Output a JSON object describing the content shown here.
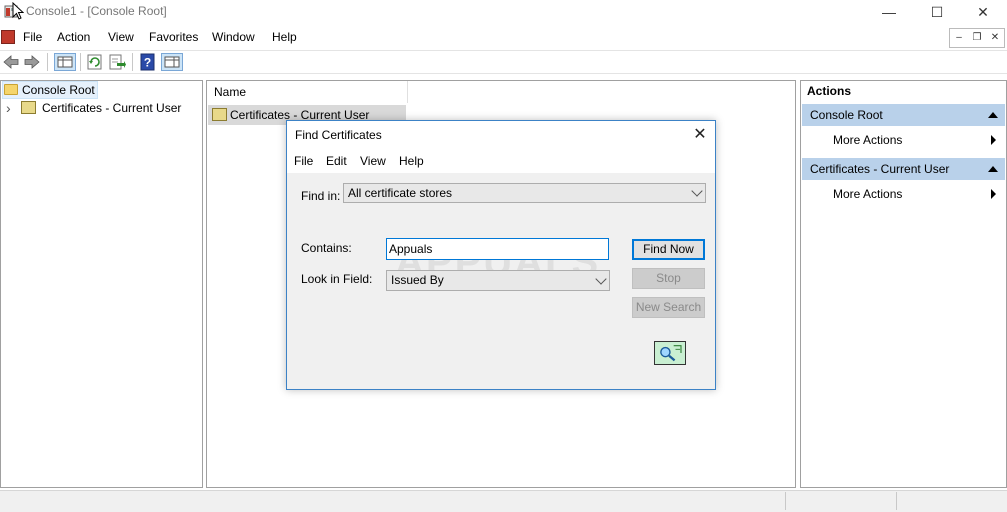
{
  "window": {
    "title": "Console1 - [Console Root]",
    "controls": {
      "minimize": "—",
      "maximize": "☐",
      "close": "✕"
    }
  },
  "menu": [
    "File",
    "Action",
    "View",
    "Favorites",
    "Window",
    "Help"
  ],
  "mdi_controls": {
    "minimize": "–",
    "restore": "❐",
    "close": "✕"
  },
  "tree": {
    "root_label": "Console Root",
    "child_label": "Certificates - Current User",
    "expand_glyph": "›"
  },
  "list": {
    "column_name": "Name",
    "items": [
      "Certificates - Current User"
    ]
  },
  "actions": {
    "title": "Actions",
    "groups": [
      {
        "header": "Console Root",
        "item": "More Actions"
      },
      {
        "header": "Certificates - Current User",
        "item": "More Actions"
      }
    ]
  },
  "dialog": {
    "title": "Find Certificates",
    "close_glyph": "✕",
    "menu": [
      "File",
      "Edit",
      "View",
      "Help"
    ],
    "find_in_label": "Find in:",
    "find_in_value": "All certificate stores",
    "contains_label": "Contains:",
    "contains_value": "Appuals",
    "look_in_label": "Look in Field:",
    "look_in_value": "Issued By",
    "buttons": {
      "find_now": "Find Now",
      "stop": "Stop",
      "new_search": "New Search"
    }
  },
  "watermark": "APPUALS",
  "colors": {
    "accent": "#0078d7",
    "actions_header": "#b9d1ea",
    "selection": "#e5f0fb"
  }
}
